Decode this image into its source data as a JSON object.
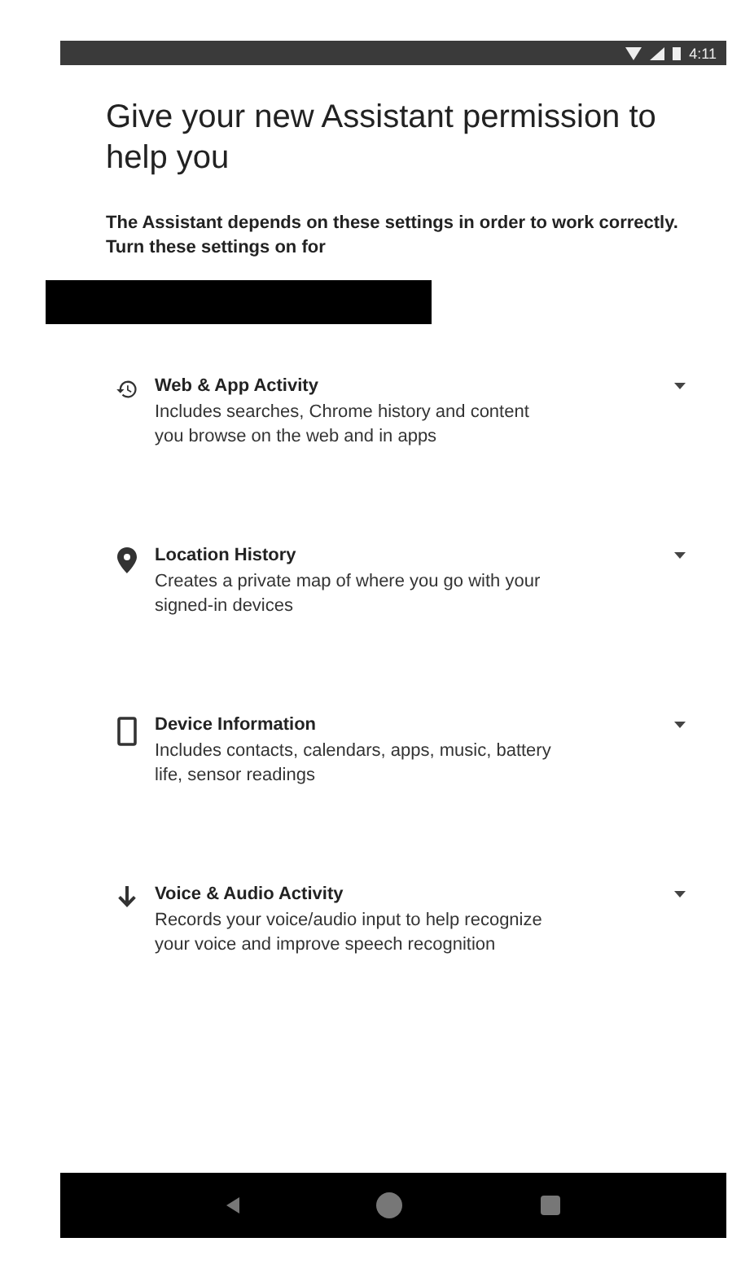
{
  "status_bar": {
    "time": "4:11"
  },
  "title": "Give your new Assistant permission to help you",
  "description": "The Assistant depends on these settings in order to work correctly. Turn these settings on for",
  "settings": [
    {
      "kind": "history",
      "title": "Web & App Activity",
      "description": "Includes searches, Chrome history and content you browse on the web and in apps",
      "expanded": false
    },
    {
      "kind": "location",
      "title": "Location History",
      "description": "Creates a private map of where you go with your signed-in devices",
      "expanded": false
    },
    {
      "kind": "device",
      "title": "Device Information",
      "description": "Includes contacts, calendars, apps, music, battery life, sensor readings",
      "expanded": false
    },
    {
      "kind": "voice",
      "title": "Voice & Audio Activity",
      "description": "Records your voice/audio input to help recognize your voice and improve speech recognition",
      "expanded": false
    }
  ]
}
